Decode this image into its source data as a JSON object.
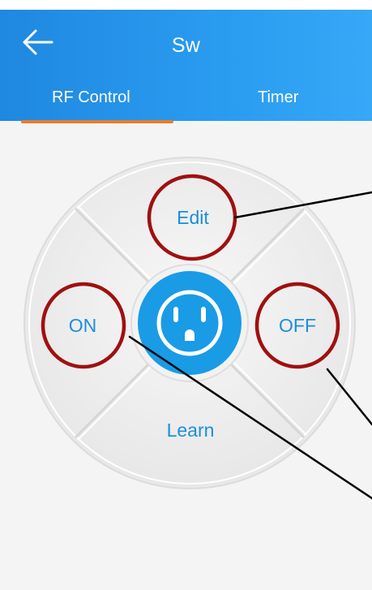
{
  "header": {
    "title": "Sw",
    "back_icon": "arrow-left-icon"
  },
  "tabs": [
    {
      "label": "RF Control",
      "active": true
    },
    {
      "label": "Timer",
      "active": false
    }
  ],
  "remote": {
    "edit_label": "Edit",
    "on_label": "ON",
    "off_label": "OFF",
    "learn_label": "Learn",
    "center_icon": "power-outlet-icon"
  },
  "colors": {
    "app_bar": "#2a9cf0",
    "tab_indicator": "#e87d2b",
    "accent_text": "#1a8fdb",
    "center_button": "#1a9be6",
    "annotation_circle": "#a01010"
  }
}
